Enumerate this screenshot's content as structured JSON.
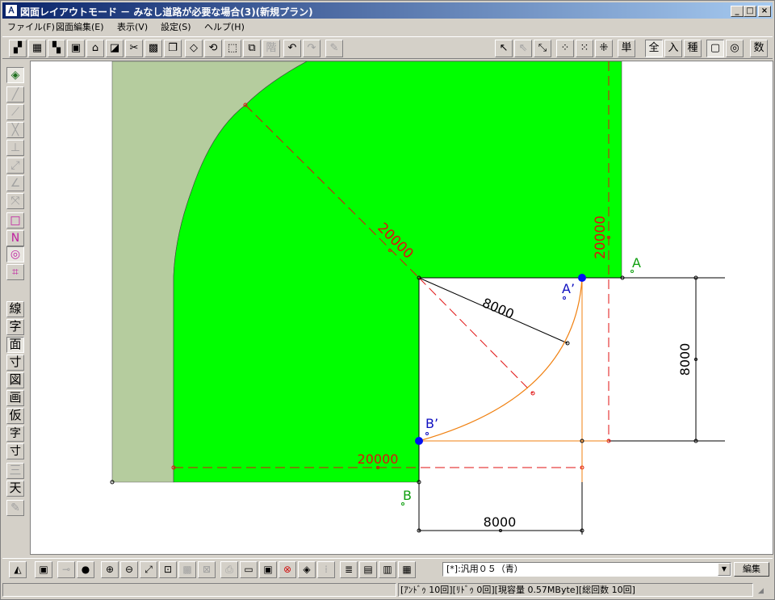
{
  "window": {
    "title": "図面レイアウトモード － みなし道路が必要な場合(3)(新規プラン)",
    "app_icon": "Ａ"
  },
  "menu": [
    "ファイル(F)",
    "図面編集(E)",
    "表示(V)",
    "設定(S)",
    "ヘルプ(H)"
  ],
  "toolbar_right_labels": {
    "single": "単",
    "all": "全",
    "input": "入",
    "kind": "種",
    "number": "数"
  },
  "left_tools_kanji": [
    "線",
    "字",
    "面",
    "寸",
    "図",
    "画",
    "仮",
    "三",
    "天"
  ],
  "drawing": {
    "labels": {
      "diag_20000": "20000",
      "vert_20000": "20000",
      "horiz_20000": "20000",
      "radius_8000": "8000",
      "right_8000": "8000",
      "bottom_8000": "8000",
      "A": "A",
      "A_prime": "A’",
      "B": "B",
      "B_prime": "B’"
    },
    "colors": {
      "green_area": "#00ff00",
      "sage_area": "#b5cc9e",
      "red_dash": "#e01010",
      "orange_arc": "#f08010",
      "blue_point": "#0010f0",
      "label_green": "#10a010",
      "label_blue": "#1010c0"
    }
  },
  "bottom": {
    "layer_select": "[*]:汎用０５（青）",
    "edit_button": "編集"
  },
  "status": {
    "text": "[ｱﾝﾄﾞｩ 10回][ﾘﾄﾞｩ 0回][現容量 0.57MByte][総回数 10回]"
  }
}
